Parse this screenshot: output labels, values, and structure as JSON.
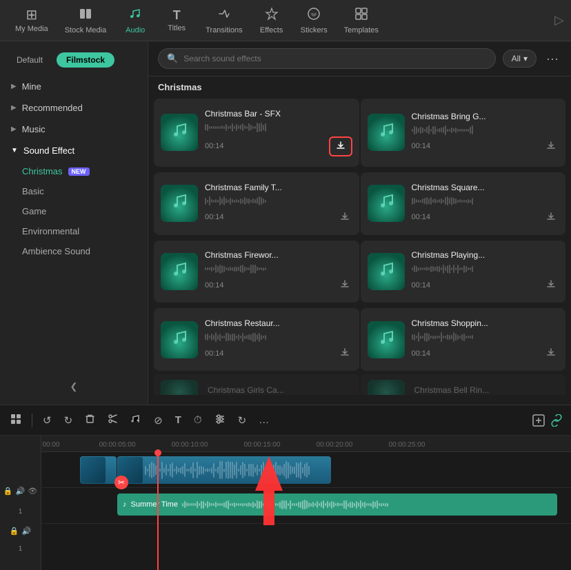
{
  "nav": {
    "items": [
      {
        "id": "my-media",
        "label": "My Media",
        "icon": "⊞",
        "active": false
      },
      {
        "id": "stock-media",
        "label": "Stock Media",
        "icon": "📦",
        "active": false
      },
      {
        "id": "audio",
        "label": "Audio",
        "icon": "🎵",
        "active": true
      },
      {
        "id": "titles",
        "label": "Titles",
        "icon": "T",
        "active": false
      },
      {
        "id": "transitions",
        "label": "Transitions",
        "icon": "↔",
        "active": false
      },
      {
        "id": "effects",
        "label": "Effects",
        "icon": "✦",
        "active": false
      },
      {
        "id": "stickers",
        "label": "Stickers",
        "icon": "⭐",
        "active": false
      },
      {
        "id": "templates",
        "label": "Templates",
        "icon": "▣",
        "active": false
      }
    ]
  },
  "sidebar": {
    "tabs": [
      {
        "id": "default",
        "label": "Default",
        "active": false
      },
      {
        "id": "filmstock",
        "label": "Filmstock",
        "active": true
      }
    ],
    "items": [
      {
        "id": "mine",
        "label": "Mine",
        "expanded": false
      },
      {
        "id": "recommended",
        "label": "Recommended",
        "expanded": false
      },
      {
        "id": "music",
        "label": "Music",
        "expanded": false
      },
      {
        "id": "sound-effect",
        "label": "Sound Effect",
        "expanded": true,
        "active": true
      }
    ],
    "sub_items": [
      {
        "id": "christmas",
        "label": "Christmas",
        "badge": "NEW",
        "active": true
      },
      {
        "id": "basic",
        "label": "Basic",
        "active": false
      },
      {
        "id": "game",
        "label": "Game",
        "active": false
      },
      {
        "id": "environmental",
        "label": "Environmental",
        "active": false
      },
      {
        "id": "ambience-sound",
        "label": "Ambience Sound",
        "active": false
      }
    ]
  },
  "search": {
    "placeholder": "Search sound effects"
  },
  "filter": {
    "label": "All",
    "chevron": "▾"
  },
  "section": {
    "label": "Christmas"
  },
  "effects": [
    {
      "id": "e1",
      "name": "Christmas Bar - SFX",
      "duration": "00:14",
      "downloaded": false,
      "highlight_download": true
    },
    {
      "id": "e2",
      "name": "Christmas Bring G...",
      "duration": "00:14",
      "downloaded": false,
      "highlight_download": false
    },
    {
      "id": "e3",
      "name": "Christmas Family T...",
      "duration": "00:14",
      "downloaded": false,
      "highlight_download": false
    },
    {
      "id": "e4",
      "name": "Christmas Square...",
      "duration": "00:14",
      "downloaded": false,
      "highlight_download": false
    },
    {
      "id": "e5",
      "name": "Christmas Firewor...",
      "duration": "00:14",
      "downloaded": false,
      "highlight_download": false
    },
    {
      "id": "e6",
      "name": "Christmas Playing...",
      "duration": "00:14",
      "downloaded": false,
      "highlight_download": false
    },
    {
      "id": "e7",
      "name": "Christmas Restaur...",
      "duration": "00:14",
      "downloaded": false,
      "highlight_download": false
    },
    {
      "id": "e8",
      "name": "Christmas Shoppin...",
      "duration": "00:14",
      "downloaded": false,
      "highlight_download": false
    }
  ],
  "timeline": {
    "tools": [
      "⊞",
      "↺",
      "↻",
      "🗑",
      "✂",
      "♪",
      "⊘",
      "T",
      "⏱",
      "≡",
      "↻",
      "…"
    ],
    "ruler_marks": [
      "00:00",
      "00:00:05:00",
      "00:00:10:00",
      "00:00:15:00",
      "00:00:20:00",
      "00:00:25:00"
    ],
    "tracks": [
      {
        "id": "track-1-video",
        "num": "1",
        "icons": [
          "🔒",
          "🔊",
          "👁"
        ],
        "type": "video"
      },
      {
        "id": "track-1-audio",
        "num": "1",
        "icons": [
          "🔒",
          "🔊"
        ],
        "type": "audio",
        "label": "Summer Time"
      }
    ]
  },
  "colors": {
    "accent_green": "#3dc6a0",
    "accent_red": "#ff4444",
    "track_blue": "#2a7a9a",
    "track_teal": "#2a9a7a",
    "badge_purple": "#6c63ff"
  }
}
